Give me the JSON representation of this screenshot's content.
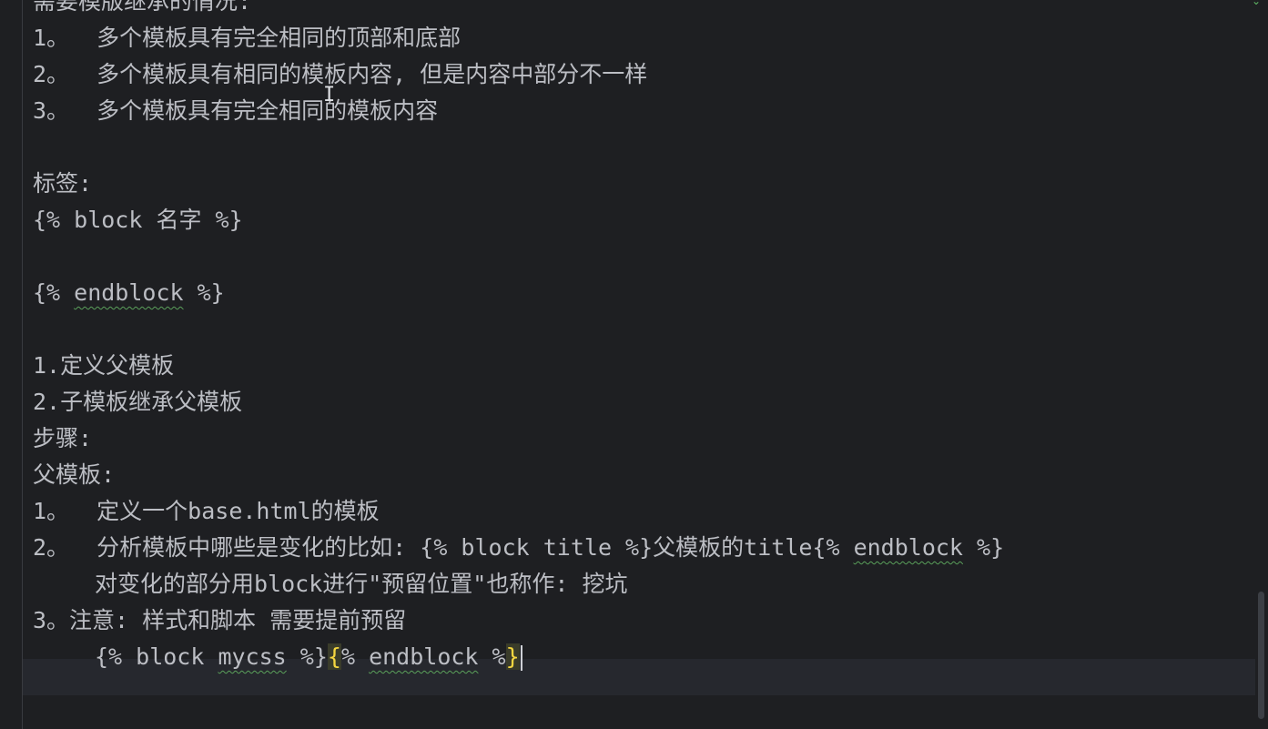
{
  "editor": {
    "lines": [
      {
        "text": "需要模版继承的情况:"
      },
      {
        "num": "1。",
        "text": "多个模板具有完全相同的顶部和底部"
      },
      {
        "num": "2。",
        "text": "多个模板具有相同的模板内容, 但是内容中部分不一样"
      },
      {
        "num": "3。",
        "text": "多个模板具有完全相同的模板内容"
      },
      {
        "text": ""
      },
      {
        "text": "标签:"
      },
      {
        "text": "{% block 名字 %}"
      },
      {
        "text": ""
      },
      {
        "pre": "{% ",
        "word": "endblock",
        "post": " %}"
      },
      {
        "text": ""
      },
      {
        "text": "1.定义父模板"
      },
      {
        "text": "2.子模板继承父模板"
      },
      {
        "text": "步骤:"
      },
      {
        "text": "父模板:"
      },
      {
        "num": "1。",
        "text": "定义一个base.html的模板"
      },
      {
        "num": "2。",
        "pre": "分析模板中哪些是变化的比如: {% block title %}父模板的title{% ",
        "word": "endblock",
        "post": " %}"
      },
      {
        "text": "对变化的部分用block进行\"预留位置\"也称作: 挖坑"
      },
      {
        "text": "3。注意: 样式和脚本 需要提前预留"
      },
      {
        "pre": "{% block ",
        "word": "mycss",
        "mid": " %}",
        "hl_open": "{",
        "mid2": "% ",
        "word2": "endblock",
        "post": " %",
        "hl_close": "}"
      }
    ]
  }
}
